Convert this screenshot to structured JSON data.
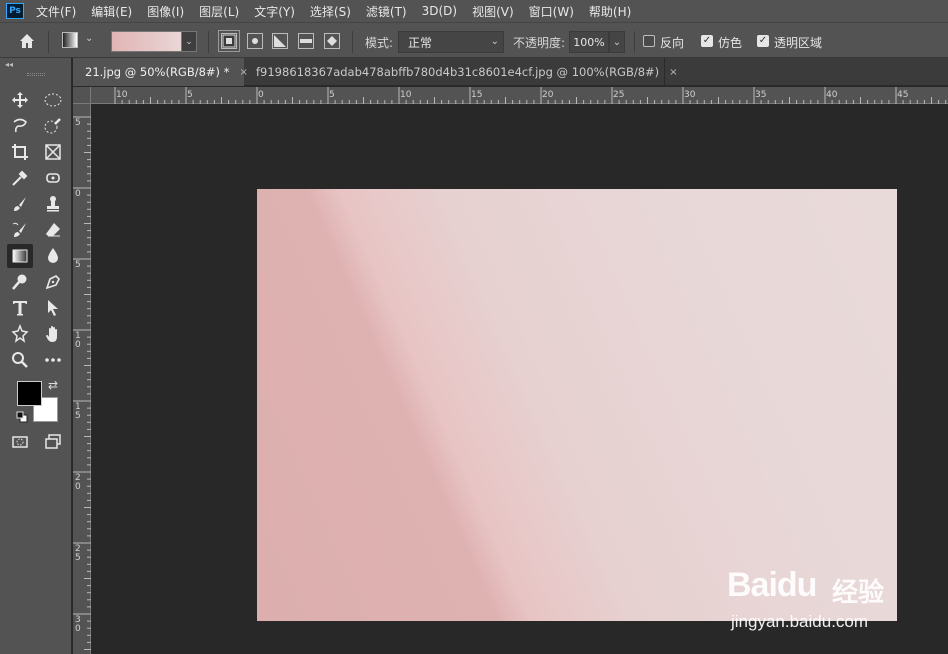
{
  "app": {
    "logo": "Ps"
  },
  "menu": [
    "文件(F)",
    "编辑(E)",
    "图像(I)",
    "图层(L)",
    "文字(Y)",
    "选择(S)",
    "滤镜(T)",
    "3D(D)",
    "视图(V)",
    "窗口(W)",
    "帮助(H)"
  ],
  "options": {
    "mode_label": "模式:",
    "mode_value": "正常",
    "opacity_label": "不透明度:",
    "opacity_value": "100%",
    "reverse_label": "反向",
    "reverse_checked": false,
    "dither_label": "仿色",
    "dither_checked": true,
    "transparency_label": "透明区域",
    "transparency_checked": true,
    "gradient_colors": [
      "#e2b4b4",
      "#ead6d6"
    ],
    "active_gradient_type": "linear"
  },
  "tabs": [
    {
      "label": "21.jpg @ 50%(RGB/8#) *",
      "close": "×",
      "active": true
    },
    {
      "label": "f9198618367adab478abffb780d4b31c8601e4cf.jpg @ 100%(RGB/8#)",
      "close": "×",
      "active": false
    }
  ],
  "ruler_h_labels": [
    "10",
    "5",
    "0",
    "5",
    "10",
    "15",
    "20",
    "25",
    "30",
    "35",
    "40",
    "45"
  ],
  "ruler_v_labels": [
    "5",
    "0",
    "5",
    "1\n0",
    "1\n5",
    "2\n0",
    "2\n5",
    "3\n0"
  ],
  "colors": {
    "foreground": "#000000",
    "background": "#ffffff",
    "accent": "#31a8ff"
  },
  "watermark": {
    "logo": "Baidu",
    "cn": "经验",
    "url": "jingyan.baidu.com"
  }
}
